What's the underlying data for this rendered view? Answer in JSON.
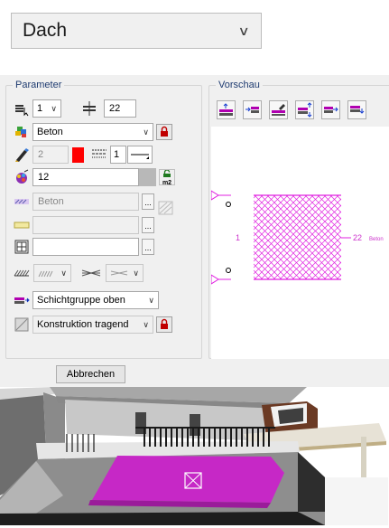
{
  "top_dropdown": {
    "value": "Dach"
  },
  "parameter": {
    "title": "Parameter",
    "count_select": "1",
    "thickness": "22",
    "material": "Beton",
    "pen": "2",
    "line": "1",
    "priority": "12",
    "hatch_name": "Beton",
    "surface_value": "",
    "layer_group": "Schichtgruppe oben",
    "construction": "Konstruktion tragend",
    "m2_label": "m2",
    "dots": "..."
  },
  "preview": {
    "title": "Vorschau",
    "label_left": "1",
    "label_right": "22",
    "label_mat": "Beton",
    "hatch_color": "#e020e0"
  },
  "buttons": {
    "cancel": "Abbrechen"
  },
  "colors": {
    "pen_red": "#ff0000",
    "magenta": "#cc33cc",
    "group_label": "#1e3b70"
  }
}
